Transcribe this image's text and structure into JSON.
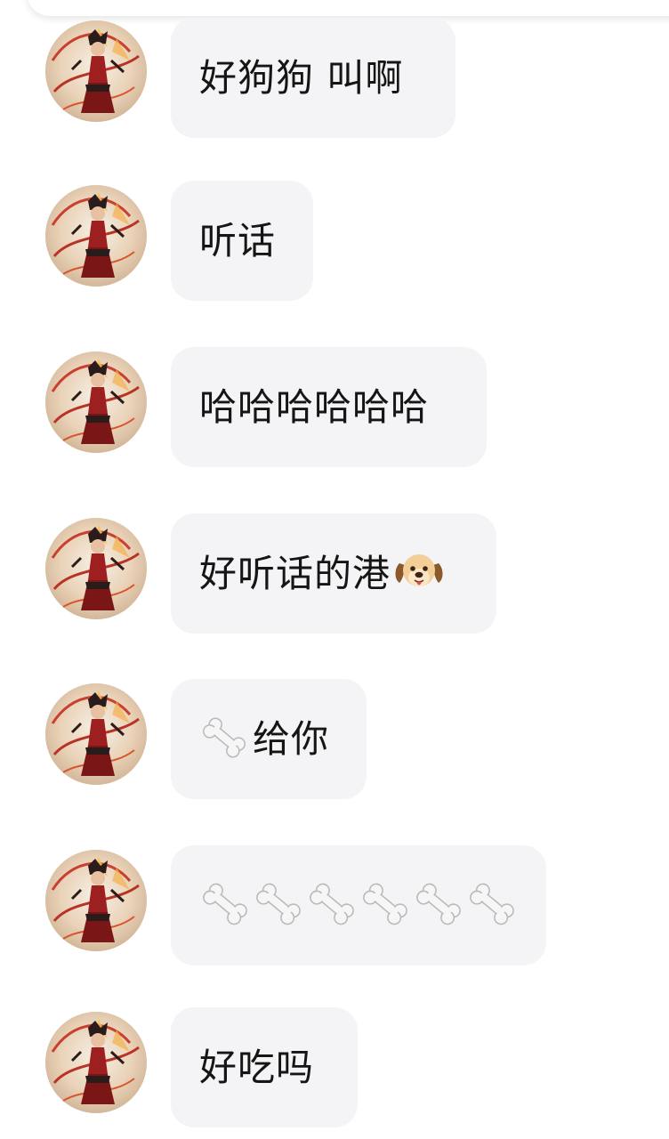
{
  "chat": {
    "messages": [
      {
        "text": "好狗狗 叫啊"
      },
      {
        "text": "听话"
      },
      {
        "text": "哈哈哈哈哈哈"
      },
      {
        "text": "好听话的港",
        "icon": "dog-face-icon"
      },
      {
        "text": "给你",
        "icon": "bone-icon"
      },
      {
        "icon": "bone-icon",
        "repeat": 6
      },
      {
        "text": "好吃吗"
      }
    ]
  },
  "colors": {
    "bubble": "#f4f4f6",
    "text": "#151515",
    "background": "#ffffff"
  }
}
